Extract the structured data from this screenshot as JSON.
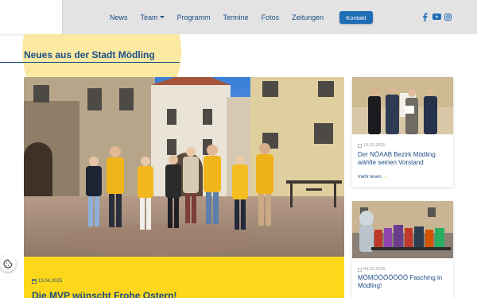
{
  "nav": {
    "items": [
      "News",
      "Team",
      "Programm",
      "Termine",
      "Fotos",
      "Zeitungen"
    ],
    "contact_label": "Kontakt"
  },
  "social": [
    "facebook-icon",
    "youtube-icon",
    "instagram-icon"
  ],
  "section": {
    "title": "Neues aus der Stadt Mödling"
  },
  "feature": {
    "date": "13.04.2025",
    "title": "Die MVP wünscht Frohe Ostern!"
  },
  "cards": [
    {
      "date": "19.03.2025",
      "title": "Der NÖAAB Bezirk Mödling wählte seinen Vorstand",
      "more": "mehr lesen"
    },
    {
      "date": "04.03.2025",
      "title": "MÖMÖÖÖÖÖÖÖ Fasching in Mödling!"
    }
  ],
  "colors": {
    "brand_blue": "#1c4f86",
    "accent_yellow": "#fdd71a",
    "button_blue": "#1f6db5"
  }
}
